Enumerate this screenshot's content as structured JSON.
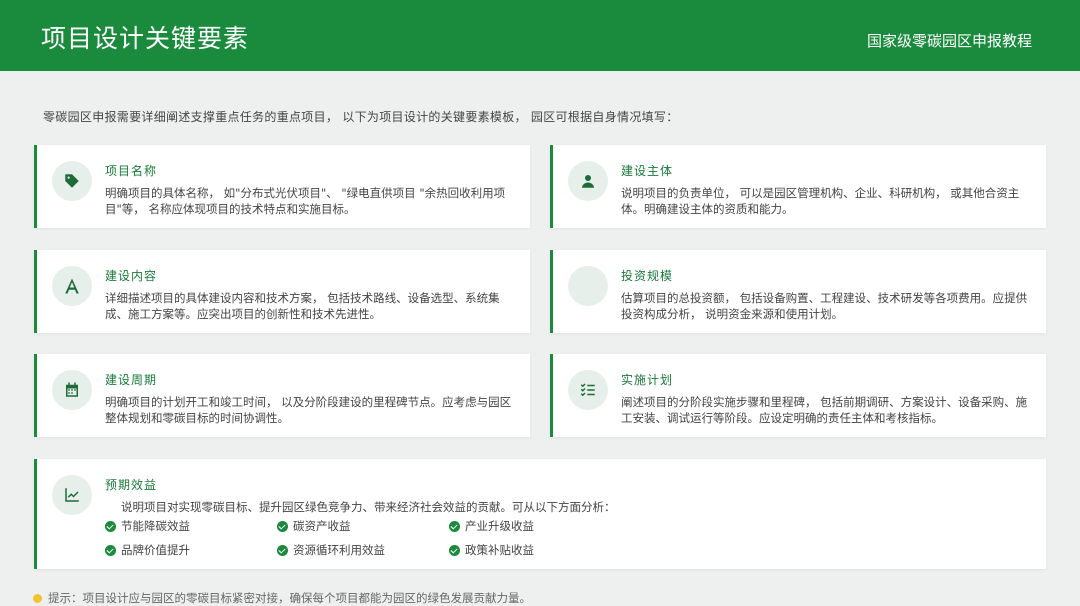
{
  "header": {
    "title": "项目设计关键要素",
    "subtitle": "国家级零碳园区申报教程"
  },
  "intro": "零碳园区申报需要详细阐述支撑重点任务的重点项目， 以下为项目设计的关键要素模板， 园区可根据自身情况填写：",
  "cards": [
    {
      "title": "项目名称",
      "icon": "tag-icon",
      "desc": "明确项目的具体名称， 如\"分布式光伏项目\"、 \"绿电直供项目 \"余热回收利用项目\"等， 名称应体现项目的技术特点和实施目标。"
    },
    {
      "title": "建设主体",
      "icon": "user-icon",
      "desc": "说明项目的负责单位， 可以是园区管理机构、企业、科研机构， 或其他合资主体。明确建设主体的资质和能力。"
    },
    {
      "title": "建设内容",
      "icon": "drafting-icon",
      "desc": "详细描述项目的具体建设内容和技术方案， 包括技术路线、设备选型、系统集成、施工方案等。应突出项目的创新性和技术先进性。"
    },
    {
      "title": "投资规模",
      "icon": "money-icon",
      "desc": "估算项目的总投资额， 包括设备购置、工程建设、技术研发等各项费用。应提供投资构成分析， 说明资金来源和使用计划。"
    },
    {
      "title": "建设周期",
      "icon": "calendar-icon",
      "desc": "明确项目的计划开工和竣工时间， 以及分阶段建设的里程碑节点。应考虑与园区整体规划和零碳目标的时间协调性。"
    },
    {
      "title": "实施计划",
      "icon": "checklist-icon",
      "desc": "阐述项目的分阶段实施步骤和里程碑， 包括前期调研、方案设计、设备采购、施工安装、调试运行等阶段。应设定明确的责任主体和考核指标。"
    }
  ],
  "benefits": {
    "title": "预期效益",
    "icon": "chart-line-icon",
    "desc": "说明项目对实现零碳目标、提升园区绿色竞争力、带来经济社会效益的贡献。可从以下方面分析：",
    "items": [
      "节能降碳效益",
      "碳资产收益",
      "产业升级收益",
      "品牌价值提升",
      "资源循环利用效益",
      "政策补贴收益"
    ]
  },
  "tip": "提示：项目设计应与园区的零碳目标紧密对接，确保每个项目都能为园区的绿色发展贡献力量。"
}
